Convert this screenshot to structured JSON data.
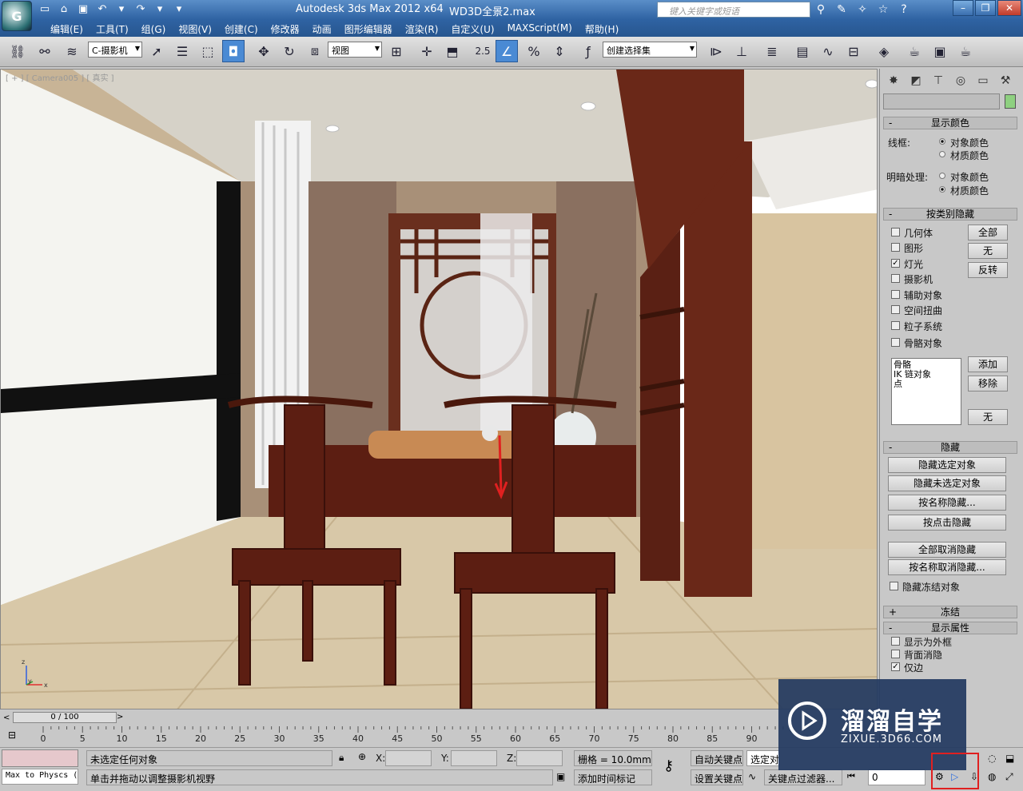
{
  "title": {
    "app": "Autodesk 3ds Max  2012 x64",
    "file": "WD3D全景2.max",
    "search_placeholder": "键入关键字或短语"
  },
  "menu": [
    "编辑(E)",
    "工具(T)",
    "组(G)",
    "视图(V)",
    "创建(C)",
    "修改器",
    "动画",
    "图形编辑器",
    "渲染(R)",
    "自定义(U)",
    "MAXScript(M)",
    "帮助(H)"
  ],
  "toolbar": {
    "selection_filter": "C-摄影机",
    "ref_coord": "视图",
    "snap_angle": "2.5",
    "named_selection": "创建选择集"
  },
  "viewport": {
    "label": "[ + ] [ Camera005 ] [ 真实 ]",
    "axis": {
      "x": "x",
      "y": "y",
      "z": "z"
    }
  },
  "command_panel": {
    "display_color": {
      "header": "显示颜色",
      "wire_label": "线框:",
      "wire_options": [
        "对象颜色",
        "材质颜色"
      ],
      "shaded_label": "明暗处理:",
      "shaded_options": [
        "对象颜色",
        "材质颜色"
      ]
    },
    "hide_by_category": {
      "header": "按类别隐藏",
      "items": [
        {
          "label": "几何体",
          "checked": false
        },
        {
          "label": "图形",
          "checked": false
        },
        {
          "label": "灯光",
          "checked": true
        },
        {
          "label": "摄影机",
          "checked": false
        },
        {
          "label": "辅助对象",
          "checked": false
        },
        {
          "label": "空间扭曲",
          "checked": false
        },
        {
          "label": "粒子系统",
          "checked": false
        },
        {
          "label": "骨骼对象",
          "checked": false
        }
      ],
      "btn_all": "全部",
      "btn_none": "无",
      "btn_invert": "反转",
      "list": [
        "骨骼",
        "IK 链对象",
        "点"
      ],
      "btn_add": "添加",
      "btn_remove": "移除",
      "btn_none2": "无"
    },
    "hide": {
      "header": "隐藏",
      "buttons": [
        "隐藏选定对象",
        "隐藏未选定对象",
        "按名称隐藏...",
        "按点击隐藏",
        "全部取消隐藏",
        "按名称取消隐藏..."
      ],
      "hide_frozen": "隐藏冻结对象"
    },
    "freeze": {
      "header": "冻结"
    },
    "display_props": {
      "header": "显示属性",
      "items": [
        {
          "label": "显示为外框",
          "checked": false
        },
        {
          "label": "背面消隐",
          "checked": false
        },
        {
          "label": "仅边",
          "checked": true
        }
      ]
    }
  },
  "timeline": {
    "position": "0 / 100",
    "ticks": [
      "0",
      "5",
      "10",
      "15",
      "20",
      "25",
      "30",
      "35",
      "40",
      "45",
      "50",
      "55",
      "60",
      "65",
      "70",
      "75",
      "80",
      "85",
      "90"
    ]
  },
  "status": {
    "script_label": "Max to Physcs (",
    "selection": "未选定任何对象",
    "prompt": "单击并拖动以调整摄影机视野",
    "x_label": "X:",
    "y_label": "Y:",
    "z_label": "Z:",
    "grid": "栅格 = 10.0mm",
    "auto_key": "自动关键点",
    "set_key": "设置关键点",
    "selected": "选定对",
    "key_filters": "关键点过滤器...",
    "add_time_tag": "添加时间标记",
    "frame": "0"
  },
  "watermark": {
    "title": "溜溜自学",
    "url": "ZIXUE.3D66.COM"
  },
  "colors": {
    "title_blue": "#2f63a3",
    "panel_grey": "#c8c8c8",
    "arrow_red": "#e02020"
  }
}
